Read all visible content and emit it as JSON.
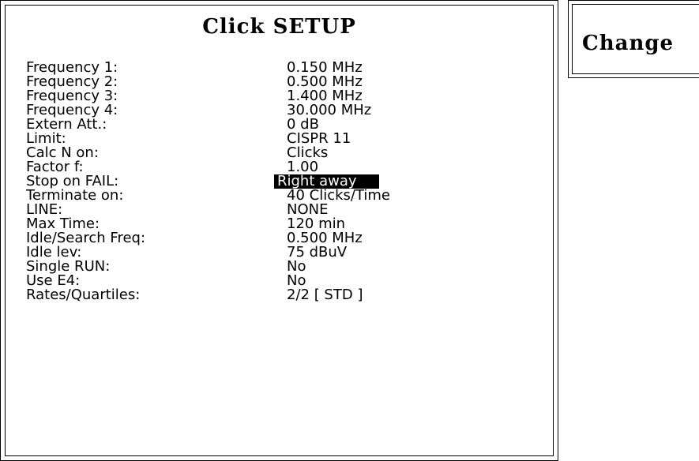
{
  "panel": {
    "title": "Click SETUP"
  },
  "side_button": {
    "label": "Change"
  },
  "settings": [
    {
      "label": "Frequency 1:",
      "value": "0.150 MHz"
    },
    {
      "label": "Frequency 2:",
      "value": "0.500 MHz"
    },
    {
      "label": "Frequency 3:",
      "value": "1.400 MHz"
    },
    {
      "label": "Frequency 4:",
      "value": "30.000 MHz"
    },
    {
      "label": "Extern Att.:",
      "value": "0 dB"
    },
    {
      "label": "Limit:",
      "value": "CISPR 11"
    },
    {
      "label": "Calc N on:",
      "value": "Clicks"
    },
    {
      "label": "Factor f:",
      "value": "1.00"
    },
    {
      "label": "Stop on FAIL:",
      "value": "Right away",
      "selected": true
    },
    {
      "label": "Terminate on:",
      "value": "40 Clicks/Time"
    },
    {
      "label": "LINE:",
      "value": "NONE"
    },
    {
      "label": "Max Time:",
      "value": "120 min"
    },
    {
      "label": "Idle/Search Freq:",
      "value": "0.500 MHz"
    },
    {
      "label": "Idle lev:",
      "value": "75 dBuV"
    },
    {
      "label": "Single RUN:",
      "value": "No"
    },
    {
      "label": "Use E4:",
      "value": "No"
    },
    {
      "label": "Rates/Quartiles:",
      "value": "2/2 [ STD ]"
    }
  ]
}
